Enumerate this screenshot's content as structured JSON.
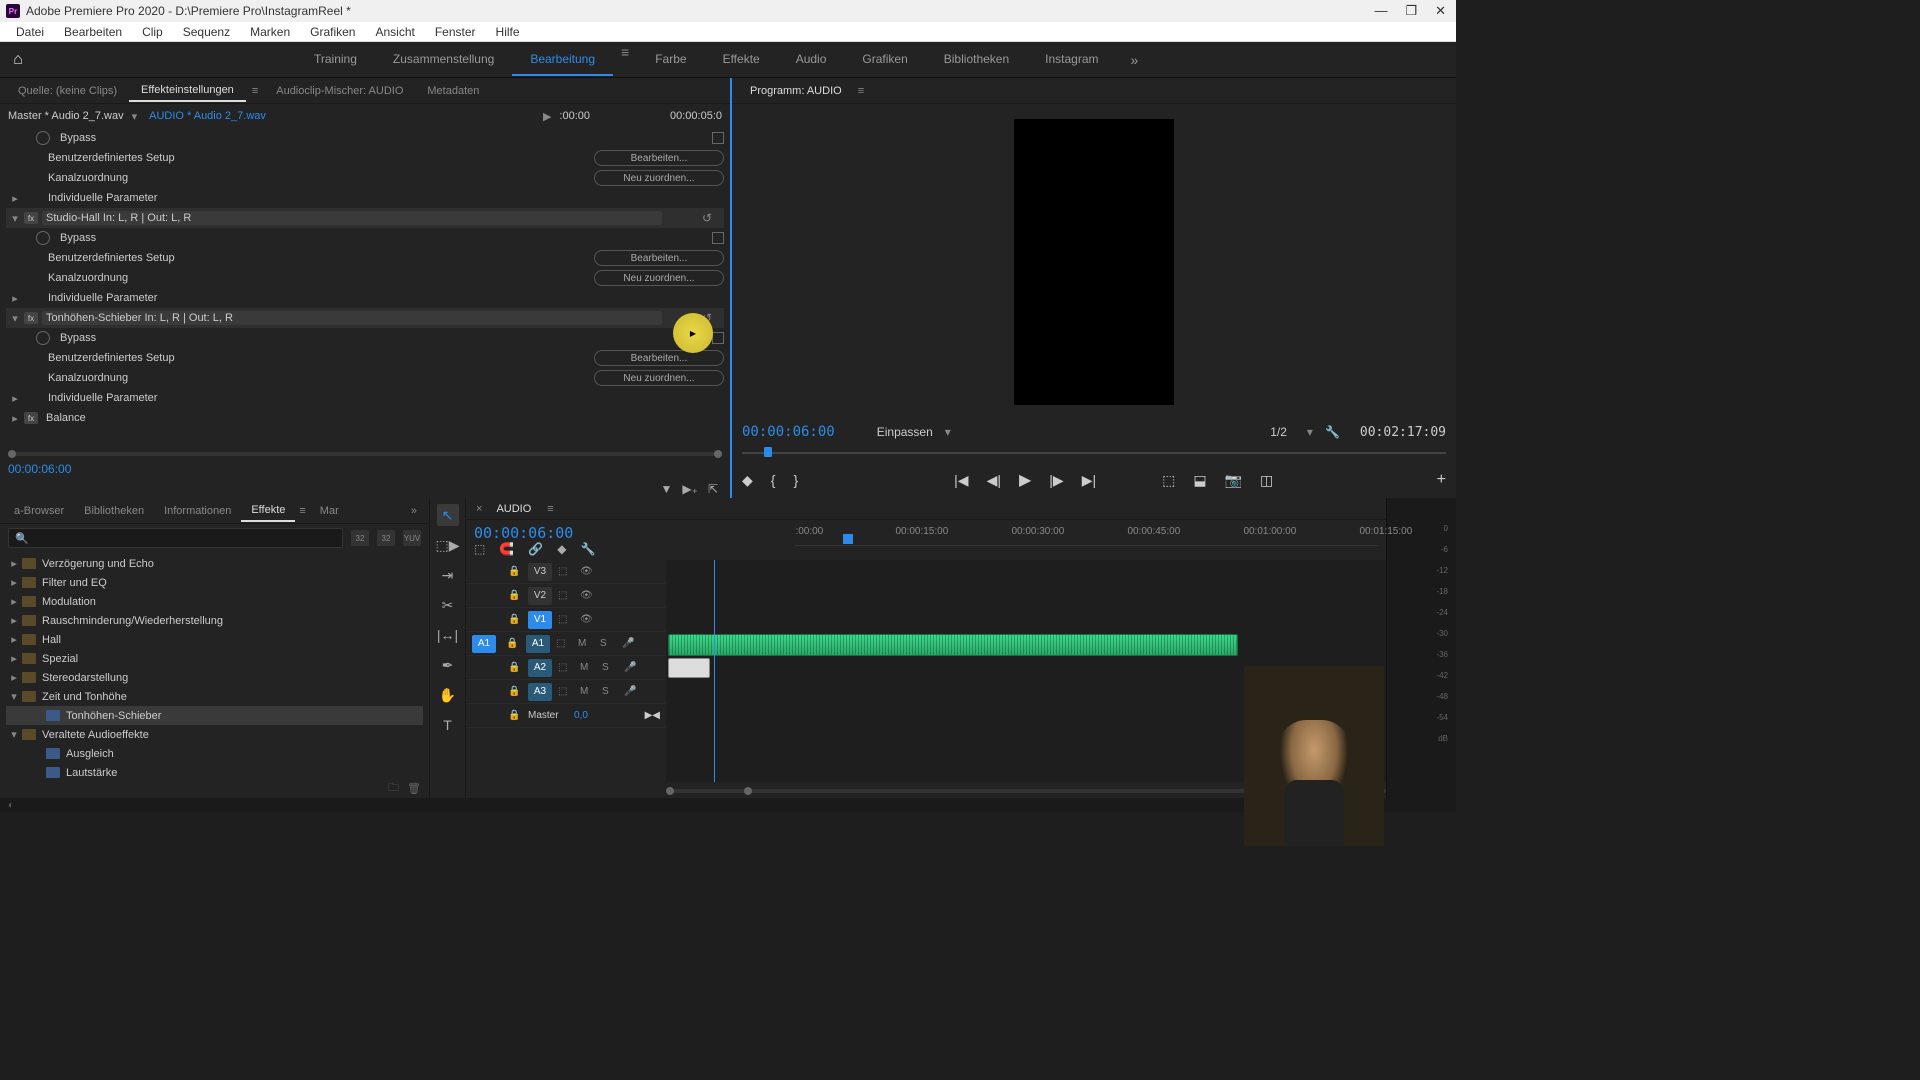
{
  "titlebar": {
    "app_badge": "Pr",
    "title": "Adobe Premiere Pro 2020 - D:\\Premiere Pro\\InstagramReel *"
  },
  "menu": [
    "Datei",
    "Bearbeiten",
    "Clip",
    "Sequenz",
    "Marken",
    "Grafiken",
    "Ansicht",
    "Fenster",
    "Hilfe"
  ],
  "workspace": {
    "items": [
      "Training",
      "Zusammenstellung",
      "Bearbeitung",
      "Farbe",
      "Effekte",
      "Audio",
      "Grafiken",
      "Bibliotheken",
      "Instagram"
    ],
    "active": "Bearbeitung"
  },
  "source_tabs": {
    "tabs": [
      {
        "label": "Quelle: (keine Clips)"
      },
      {
        "label": "Effekteinstellungen",
        "active": true
      },
      {
        "label": "Audioclip-Mischer: AUDIO"
      },
      {
        "label": "Metadaten"
      }
    ]
  },
  "effect_controls": {
    "master": "Master * Audio 2_7.wav",
    "clip": "AUDIO * Audio 2_7.wav",
    "tc_left": ":00:00",
    "tc_right": "00:00:05:0",
    "effects": [
      {
        "bypass": "Bypass",
        "setup": "Benutzerdefiniertes Setup",
        "setup_btn": "Bearbeiten...",
        "channel": "Kanalzuordnung",
        "channel_btn": "Neu zuordnen...",
        "params": "Individuelle Parameter"
      },
      {
        "name": "Studio-Hall In: L, R | Out: L, R",
        "bypass": "Bypass",
        "setup": "Benutzerdefiniertes Setup",
        "setup_btn": "Bearbeiten...",
        "channel": "Kanalzuordnung",
        "channel_btn": "Neu zuordnen...",
        "params": "Individuelle Parameter"
      },
      {
        "name": "Tonhöhen-Schieber In: L, R | Out: L, R",
        "bypass": "Bypass",
        "setup": "Benutzerdefiniertes Setup",
        "setup_btn": "Bearbeiten...",
        "channel": "Kanalzuordnung",
        "channel_btn": "Neu zuordnen...",
        "params": "Individuelle Parameter"
      },
      {
        "name": "Balance"
      }
    ],
    "timecode": "00:00:06:00"
  },
  "program": {
    "title": "Programm: AUDIO",
    "tc_current": "00:00:06:00",
    "fit": "Einpassen",
    "zoom": "1/2",
    "tc_duration": "00:02:17:09"
  },
  "effects_panel": {
    "tabs": [
      "a-Browser",
      "Bibliotheken",
      "Informationen",
      "Effekte",
      "Mar"
    ],
    "active": "Effekte",
    "badges": [
      "32",
      "32",
      "YUV"
    ],
    "tree": [
      {
        "label": "Verzögerung und Echo",
        "type": "folder"
      },
      {
        "label": "Filter und EQ",
        "type": "folder"
      },
      {
        "label": "Modulation",
        "type": "folder"
      },
      {
        "label": "Rauschminderung/Wiederherstellung",
        "type": "folder"
      },
      {
        "label": "Hall",
        "type": "folder"
      },
      {
        "label": "Spezial",
        "type": "folder"
      },
      {
        "label": "Stereodarstellung",
        "type": "folder"
      },
      {
        "label": "Zeit und Tonhöhe",
        "type": "folder",
        "expanded": true
      },
      {
        "label": "Tonhöhen-Schieber",
        "type": "preset",
        "child": true,
        "selected": true
      },
      {
        "label": "Veraltete Audioeffekte",
        "type": "folder",
        "expanded": true
      },
      {
        "label": "Ausgleich",
        "type": "preset",
        "child": true
      },
      {
        "label": "Lautstärke",
        "type": "preset",
        "child": true
      }
    ]
  },
  "timeline": {
    "seq_name": "AUDIO",
    "timecode": "00:00:06:00",
    "ruler": [
      ":00:00",
      "00:00:15:00",
      "00:00:30:00",
      "00:00:45:00",
      "00:01:00:00",
      "00:01:15:00"
    ],
    "tracks": {
      "v3": "V3",
      "v2": "V2",
      "v1": "V1",
      "a1": "A1",
      "a2": "A2",
      "a3": "A3",
      "src_a1": "A1",
      "master": "Master",
      "master_val": "0,0"
    },
    "mute": "M",
    "solo": "S"
  },
  "meters": [
    "0",
    "-6",
    "-12",
    "-18",
    "-24",
    "-30",
    "-36",
    "-42",
    "-48",
    "-54",
    "dB"
  ]
}
